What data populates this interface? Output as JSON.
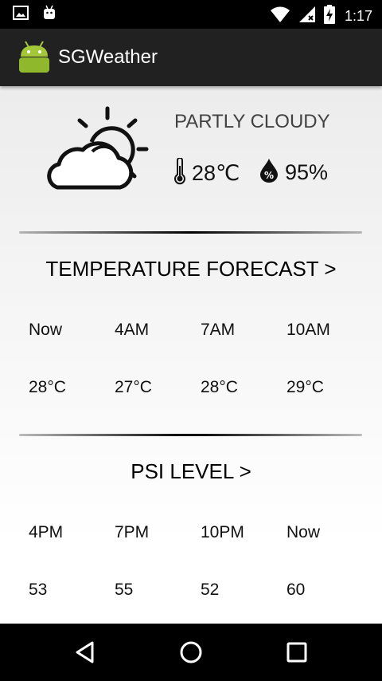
{
  "status_bar": {
    "time": "1:17",
    "icons": [
      "image-icon",
      "android-debug-icon",
      "wifi-icon",
      "signal-icon",
      "battery-charging-icon"
    ]
  },
  "app_bar": {
    "title": "SGWeather",
    "icon": "android-launcher-icon"
  },
  "current": {
    "condition": "PARTLY CLOUDY",
    "temperature": "28℃",
    "humidity": "95%",
    "weather_icon": "partly-cloudy-icon"
  },
  "temperature_forecast": {
    "title": "TEMPERATURE FORECAST >",
    "times": [
      "Now",
      "4AM",
      "7AM",
      "10AM"
    ],
    "values": [
      "28°C",
      "27°C",
      "28°C",
      "29°C"
    ]
  },
  "psi": {
    "title": "PSI LEVEL >",
    "times": [
      "4PM",
      "7PM",
      "10PM",
      "Now"
    ],
    "values": [
      "53",
      "55",
      "52",
      "60"
    ]
  },
  "nav_bar": {
    "buttons": [
      "back-icon",
      "home-icon",
      "recents-icon"
    ]
  }
}
